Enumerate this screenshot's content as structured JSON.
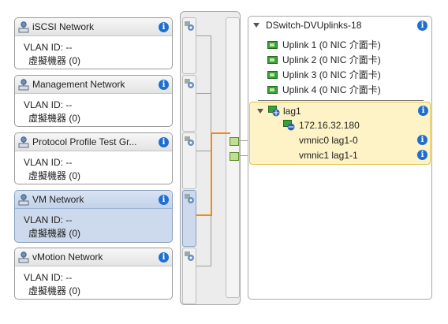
{
  "port_groups": [
    {
      "name": "iSCSI Network",
      "vlan": "VLAN ID: --",
      "vms": "虛擬機器 (0)",
      "selected": false
    },
    {
      "name": "Management Network",
      "vlan": "VLAN ID: --",
      "vms": "虛擬機器 (0)",
      "selected": false
    },
    {
      "name": "Protocol Profile Test Gr...",
      "vlan": "VLAN ID: --",
      "vms": "虛擬機器 (0)",
      "selected": false
    },
    {
      "name": "VM Network",
      "vlan": "VLAN ID: --",
      "vms": "虛擬機器 (0)",
      "selected": true
    },
    {
      "name": "vMotion Network",
      "vlan": "VLAN ID: --",
      "vms": "虛擬機器 (0)",
      "selected": false
    }
  ],
  "uplinks": {
    "title": "DSwitch-DVUplinks-18",
    "items": [
      "Uplink 1 (0 NIC 介面卡)",
      "Uplink 2 (0 NIC 介面卡)",
      "Uplink 3 (0 NIC 介面卡)",
      "Uplink 4 (0 NIC 介面卡)"
    ],
    "lag": {
      "name": "lag1",
      "host_ip": "172.16.32.180",
      "vmnics": [
        "vmnic0 lag1-0",
        "vmnic1 lag1-1"
      ]
    }
  },
  "icons": {
    "info": "i",
    "port_group": "network-icon",
    "port": "portgroup-port-icon",
    "nic": "nic-card-icon",
    "lag": "lag-icon",
    "host": "host-icon",
    "expand": "expand-triangle-icon"
  },
  "colors": {
    "selected_bg": "#cdd9ec",
    "active_wire": "#f08a10",
    "lag_bg": "#fdf3c6",
    "info_blue": "#1f6fd1",
    "nic_green": "#3aa03a"
  }
}
